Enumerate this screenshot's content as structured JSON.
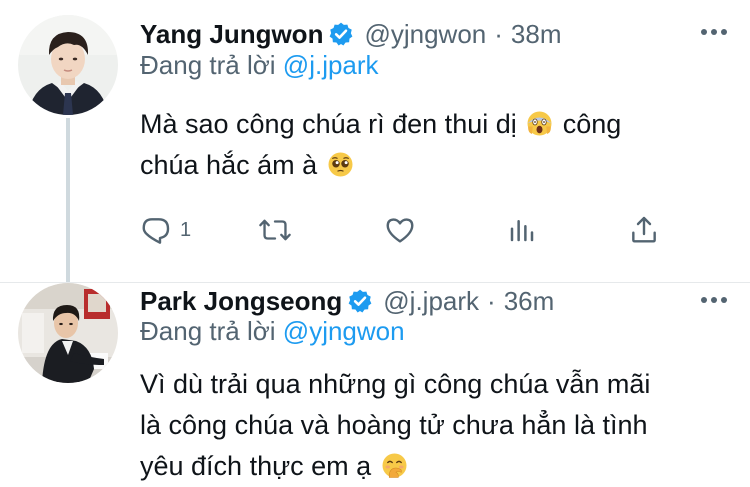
{
  "tweets": [
    {
      "display_name": "Yang Jungwon",
      "handle": "@yjngwon",
      "separator": "·",
      "time": "38m",
      "reply_prefix": "Đang trả lời",
      "reply_to": "@j.jpark",
      "body_line1_before_emoji": "Mà sao công chúa rì đen thui dị",
      "body_line1_after_emoji": "công",
      "body_line2_text": "chúa hắc ám à",
      "emojis": [
        "face-screaming-in-fear",
        "pleading-face"
      ],
      "reply_count": "1"
    },
    {
      "display_name": "Park Jongseong",
      "handle": "@j.jpark",
      "separator": "·",
      "time": "36m",
      "reply_prefix": "Đang trả lời",
      "reply_to": "@yjngwon",
      "body_line1": "Vì dù trải qua những gì công chúa vẫn mãi",
      "body_line2": "là công chúa và hoàng tử chưa hẳn là tình",
      "body_line3_text": "yêu đích thực em ạ",
      "emojis": [
        "face-with-hand-over-mouth"
      ]
    }
  ],
  "colors": {
    "text": "#0f1419",
    "secondary": "#536471",
    "link": "#1d9bf0",
    "verified": "#1d9bf0",
    "thread_line": "#cfd9de"
  },
  "icons": [
    "verified-badge-icon",
    "more-icon",
    "reply-icon",
    "retweet-icon",
    "like-icon",
    "analytics-icon",
    "share-icon"
  ]
}
